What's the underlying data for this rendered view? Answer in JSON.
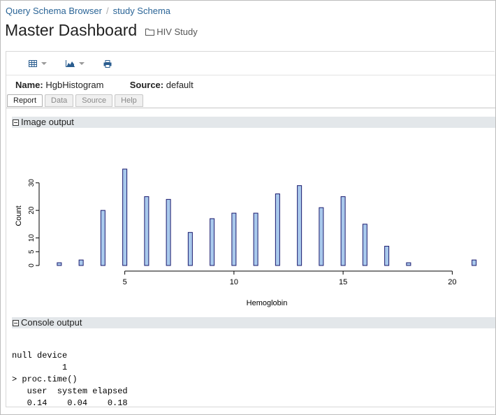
{
  "breadcrumb": {
    "items": [
      "Query Schema Browser",
      "study Schema"
    ]
  },
  "page": {
    "title": "Master Dashboard",
    "folder_link": "HIV Study"
  },
  "toolbar": {
    "buttons": [
      "grid-icon",
      "chart-icon",
      "print-icon"
    ]
  },
  "report": {
    "name_label": "Name:",
    "name_value": "HgbHistogram",
    "source_label": "Source:",
    "source_value": "default"
  },
  "tabs": [
    {
      "label": "Report",
      "active": true
    },
    {
      "label": "Data",
      "active": false
    },
    {
      "label": "Source",
      "active": false
    },
    {
      "label": "Help",
      "active": false
    }
  ],
  "sections": {
    "image_output": "Image output",
    "console_output": "Console output"
  },
  "console_lines": [
    "null device",
    "          1",
    "> proc.time()",
    "   user  system elapsed",
    "   0.14    0.04    0.18"
  ],
  "chart_data": {
    "type": "bar",
    "xlabel": "Hemoglobin",
    "ylabel": "Count",
    "xlim": [
      1.3,
      21.3
    ],
    "ylim": [
      0,
      35
    ],
    "x_ticks": [
      5,
      10,
      15,
      20
    ],
    "y_ticks": [
      0,
      5,
      10,
      20,
      30
    ],
    "bar_fill": "#a9c9ec",
    "bar_stroke": "#1a1a6e",
    "x": [
      2,
      3,
      4,
      5,
      6,
      7,
      8,
      9,
      10,
      11,
      12,
      13,
      14,
      15,
      16,
      17,
      18,
      21
    ],
    "values": [
      1,
      2,
      20,
      35,
      25,
      24,
      12,
      17,
      19,
      19,
      26,
      29,
      21,
      25,
      15,
      7,
      1,
      2
    ]
  }
}
